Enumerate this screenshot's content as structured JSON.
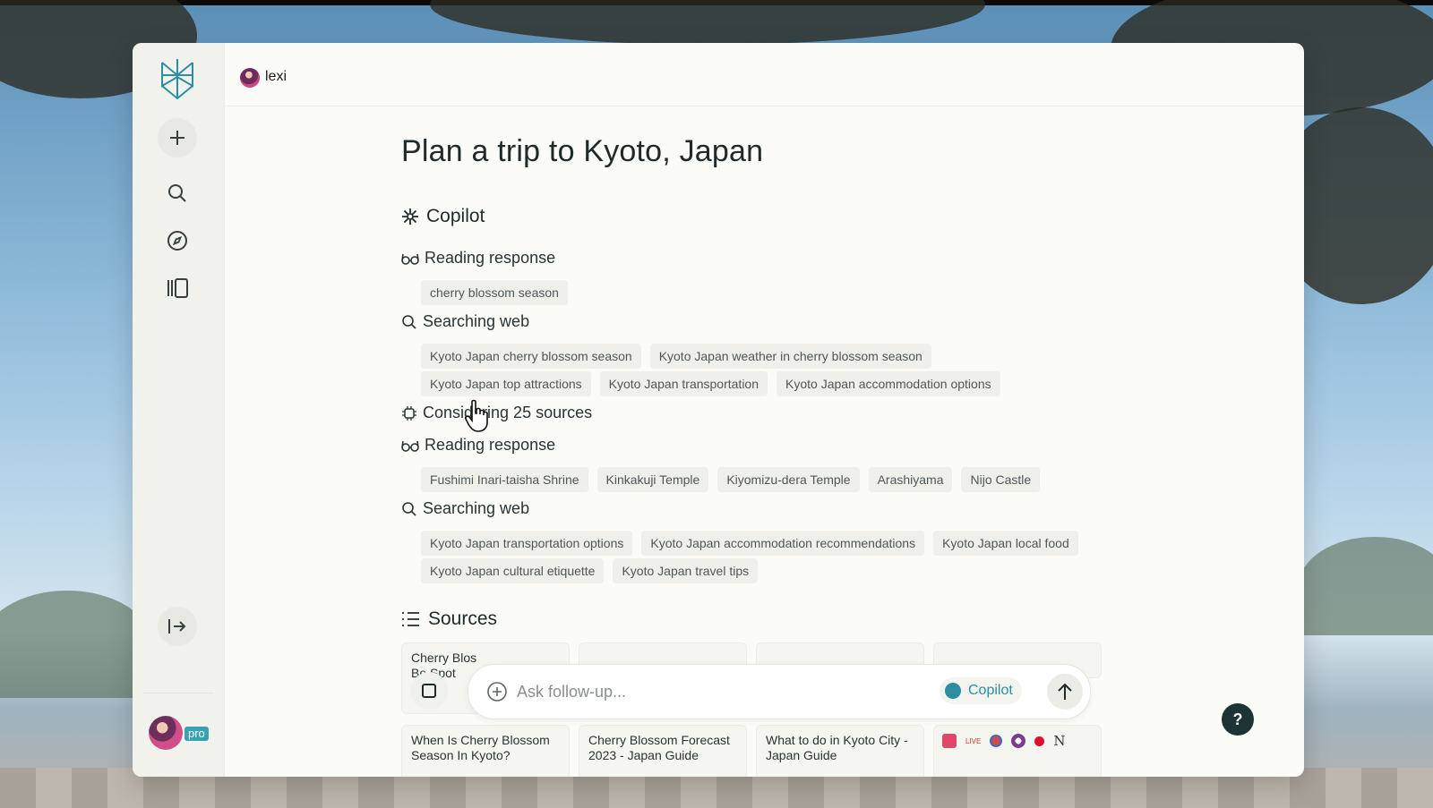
{
  "header": {
    "user_name": "lexi"
  },
  "sidebar": {
    "pro_badge": "pro"
  },
  "main": {
    "title": "Plan a trip to Kyoto, Japan",
    "copilot_heading": "Copilot",
    "steps": [
      {
        "label": "Reading response",
        "chips": [
          "cherry blossom season"
        ]
      },
      {
        "label": "Searching web",
        "chips": [
          "Kyoto Japan cherry blossom season",
          "Kyoto Japan weather in cherry blossom season"
        ],
        "chips2": [
          "Kyoto Japan top attractions",
          "Kyoto Japan transportation",
          "Kyoto Japan accommodation options"
        ]
      },
      {
        "label": "Considering 25 sources"
      },
      {
        "label": "Reading response",
        "chips": [
          "Fushimi Inari-taisha Shrine",
          "Kinkakuji Temple",
          "Kiyomizu-dera Temple",
          "Arashiyama",
          "Nijo Castle"
        ]
      },
      {
        "label": "Searching web",
        "chips": [
          "Kyoto Japan transportation options",
          "Kyoto Japan accommodation recommendations",
          "Kyoto Japan local food"
        ],
        "chips2": [
          "Kyoto Japan cultural etiquette",
          "Kyoto Japan travel tips"
        ]
      }
    ],
    "sources_heading": "Sources",
    "source_cards_top": [
      "Cherry Blos",
      "Be Spot"
    ],
    "source_cards_bottom": [
      "When Is Cherry Blossom Season In Kyoto?",
      "Cherry Blossom Forecast 2023 - Japan Guide",
      "What to do in Kyoto City - Japan Guide"
    ],
    "favicon_n": "N",
    "favicon_live": "LIVE"
  },
  "ask": {
    "placeholder": "Ask follow-up...",
    "copilot_label": "Copilot"
  },
  "help": {
    "label": "?"
  },
  "colors": {
    "accent": "#2b8ea2",
    "text": "#1f2a2a"
  }
}
